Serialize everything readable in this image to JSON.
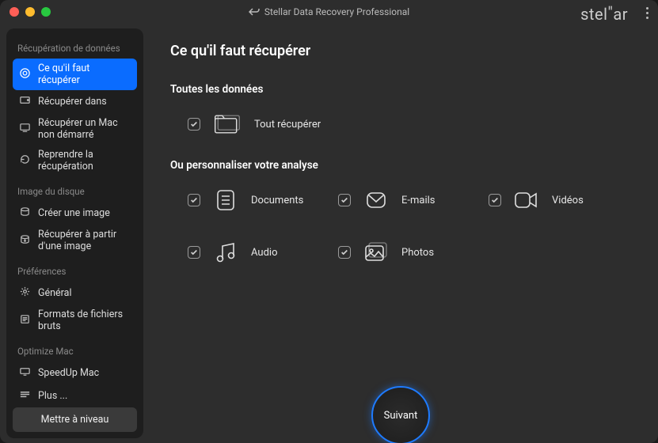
{
  "window": {
    "title": "Stellar Data Recovery Professional",
    "brand": "stellar"
  },
  "sidebar": {
    "sections": [
      {
        "label": "Récupération de données",
        "items": [
          {
            "label": "Ce qu'il faut récupérer",
            "icon": "target-icon",
            "active": true
          },
          {
            "label": "Récupérer dans",
            "icon": "drive-icon",
            "active": false
          },
          {
            "label": "Récupérer un Mac non démarré",
            "icon": "mac-icon",
            "active": false
          },
          {
            "label": "Reprendre la récupération",
            "icon": "resume-icon",
            "active": false
          }
        ]
      },
      {
        "label": "Image du disque",
        "items": [
          {
            "label": "Créer une image",
            "icon": "create-image-icon",
            "active": false
          },
          {
            "label": "Récupérer à partir d'une image",
            "icon": "recover-image-icon",
            "active": false
          }
        ]
      },
      {
        "label": "Préférences",
        "items": [
          {
            "label": "Général",
            "icon": "gear-icon",
            "active": false
          },
          {
            "label": "Formats de fichiers bruts",
            "icon": "raw-icon",
            "active": false
          }
        ]
      },
      {
        "label": "Optimize Mac",
        "items": [
          {
            "label": "SpeedUp Mac",
            "icon": "speedup-icon",
            "active": false
          },
          {
            "label": "Plus ...",
            "icon": "more-icon",
            "active": false
          }
        ]
      }
    ],
    "upgrade_label": "Mettre à niveau"
  },
  "main": {
    "title": "Ce qu'il faut récupérer",
    "all_heading": "Toutes les données",
    "recover_all": {
      "label": "Tout récupérer",
      "checked": true
    },
    "customize_heading": "Ou personnaliser votre analyse",
    "options": [
      {
        "label": "Documents",
        "icon": "documents-icon",
        "checked": true
      },
      {
        "label": "E-mails",
        "icon": "emails-icon",
        "checked": true
      },
      {
        "label": "Vidéos",
        "icon": "videos-icon",
        "checked": true
      },
      {
        "label": "Audio",
        "icon": "audio-icon",
        "checked": true
      },
      {
        "label": "Photos",
        "icon": "photos-icon",
        "checked": true
      }
    ],
    "next_label": "Suivant"
  }
}
